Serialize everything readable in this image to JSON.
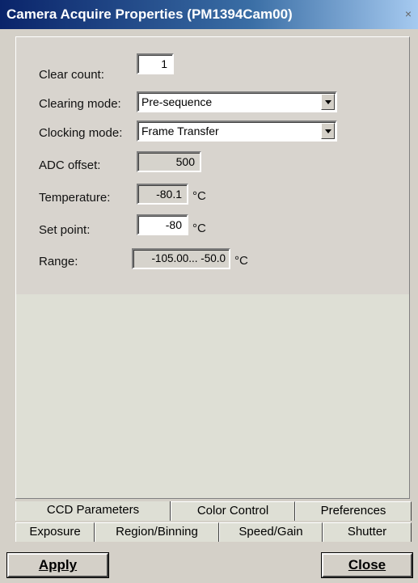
{
  "window": {
    "title": "Camera Acquire Properties (PM1394Cam00)",
    "close_glyph": "×"
  },
  "fields": {
    "clear_count": {
      "label": "Clear count:",
      "value": "1"
    },
    "clearing_mode": {
      "label": "Clearing mode:",
      "value": "Pre-sequence"
    },
    "clocking_mode": {
      "label": "Clocking mode:",
      "value": "Frame Transfer"
    },
    "adc_offset": {
      "label": "ADC offset:",
      "value": "500"
    },
    "temperature": {
      "label": "Temperature:",
      "value": "-80.1",
      "unit": "°C"
    },
    "set_point": {
      "label": "Set point:",
      "value": "-80",
      "unit": "°C"
    },
    "range": {
      "label": "Range:",
      "value": "-105.00... -50.0",
      "unit": "°C"
    }
  },
  "tabs_row1": [
    "CCD Parameters",
    "Color Control",
    "Preferences"
  ],
  "tabs_row2": [
    "Exposure",
    "Region/Binning",
    "Speed/Gain",
    "Shutter"
  ],
  "active_tab": "CCD Parameters",
  "buttons": {
    "apply": "Apply",
    "close": "Close"
  }
}
